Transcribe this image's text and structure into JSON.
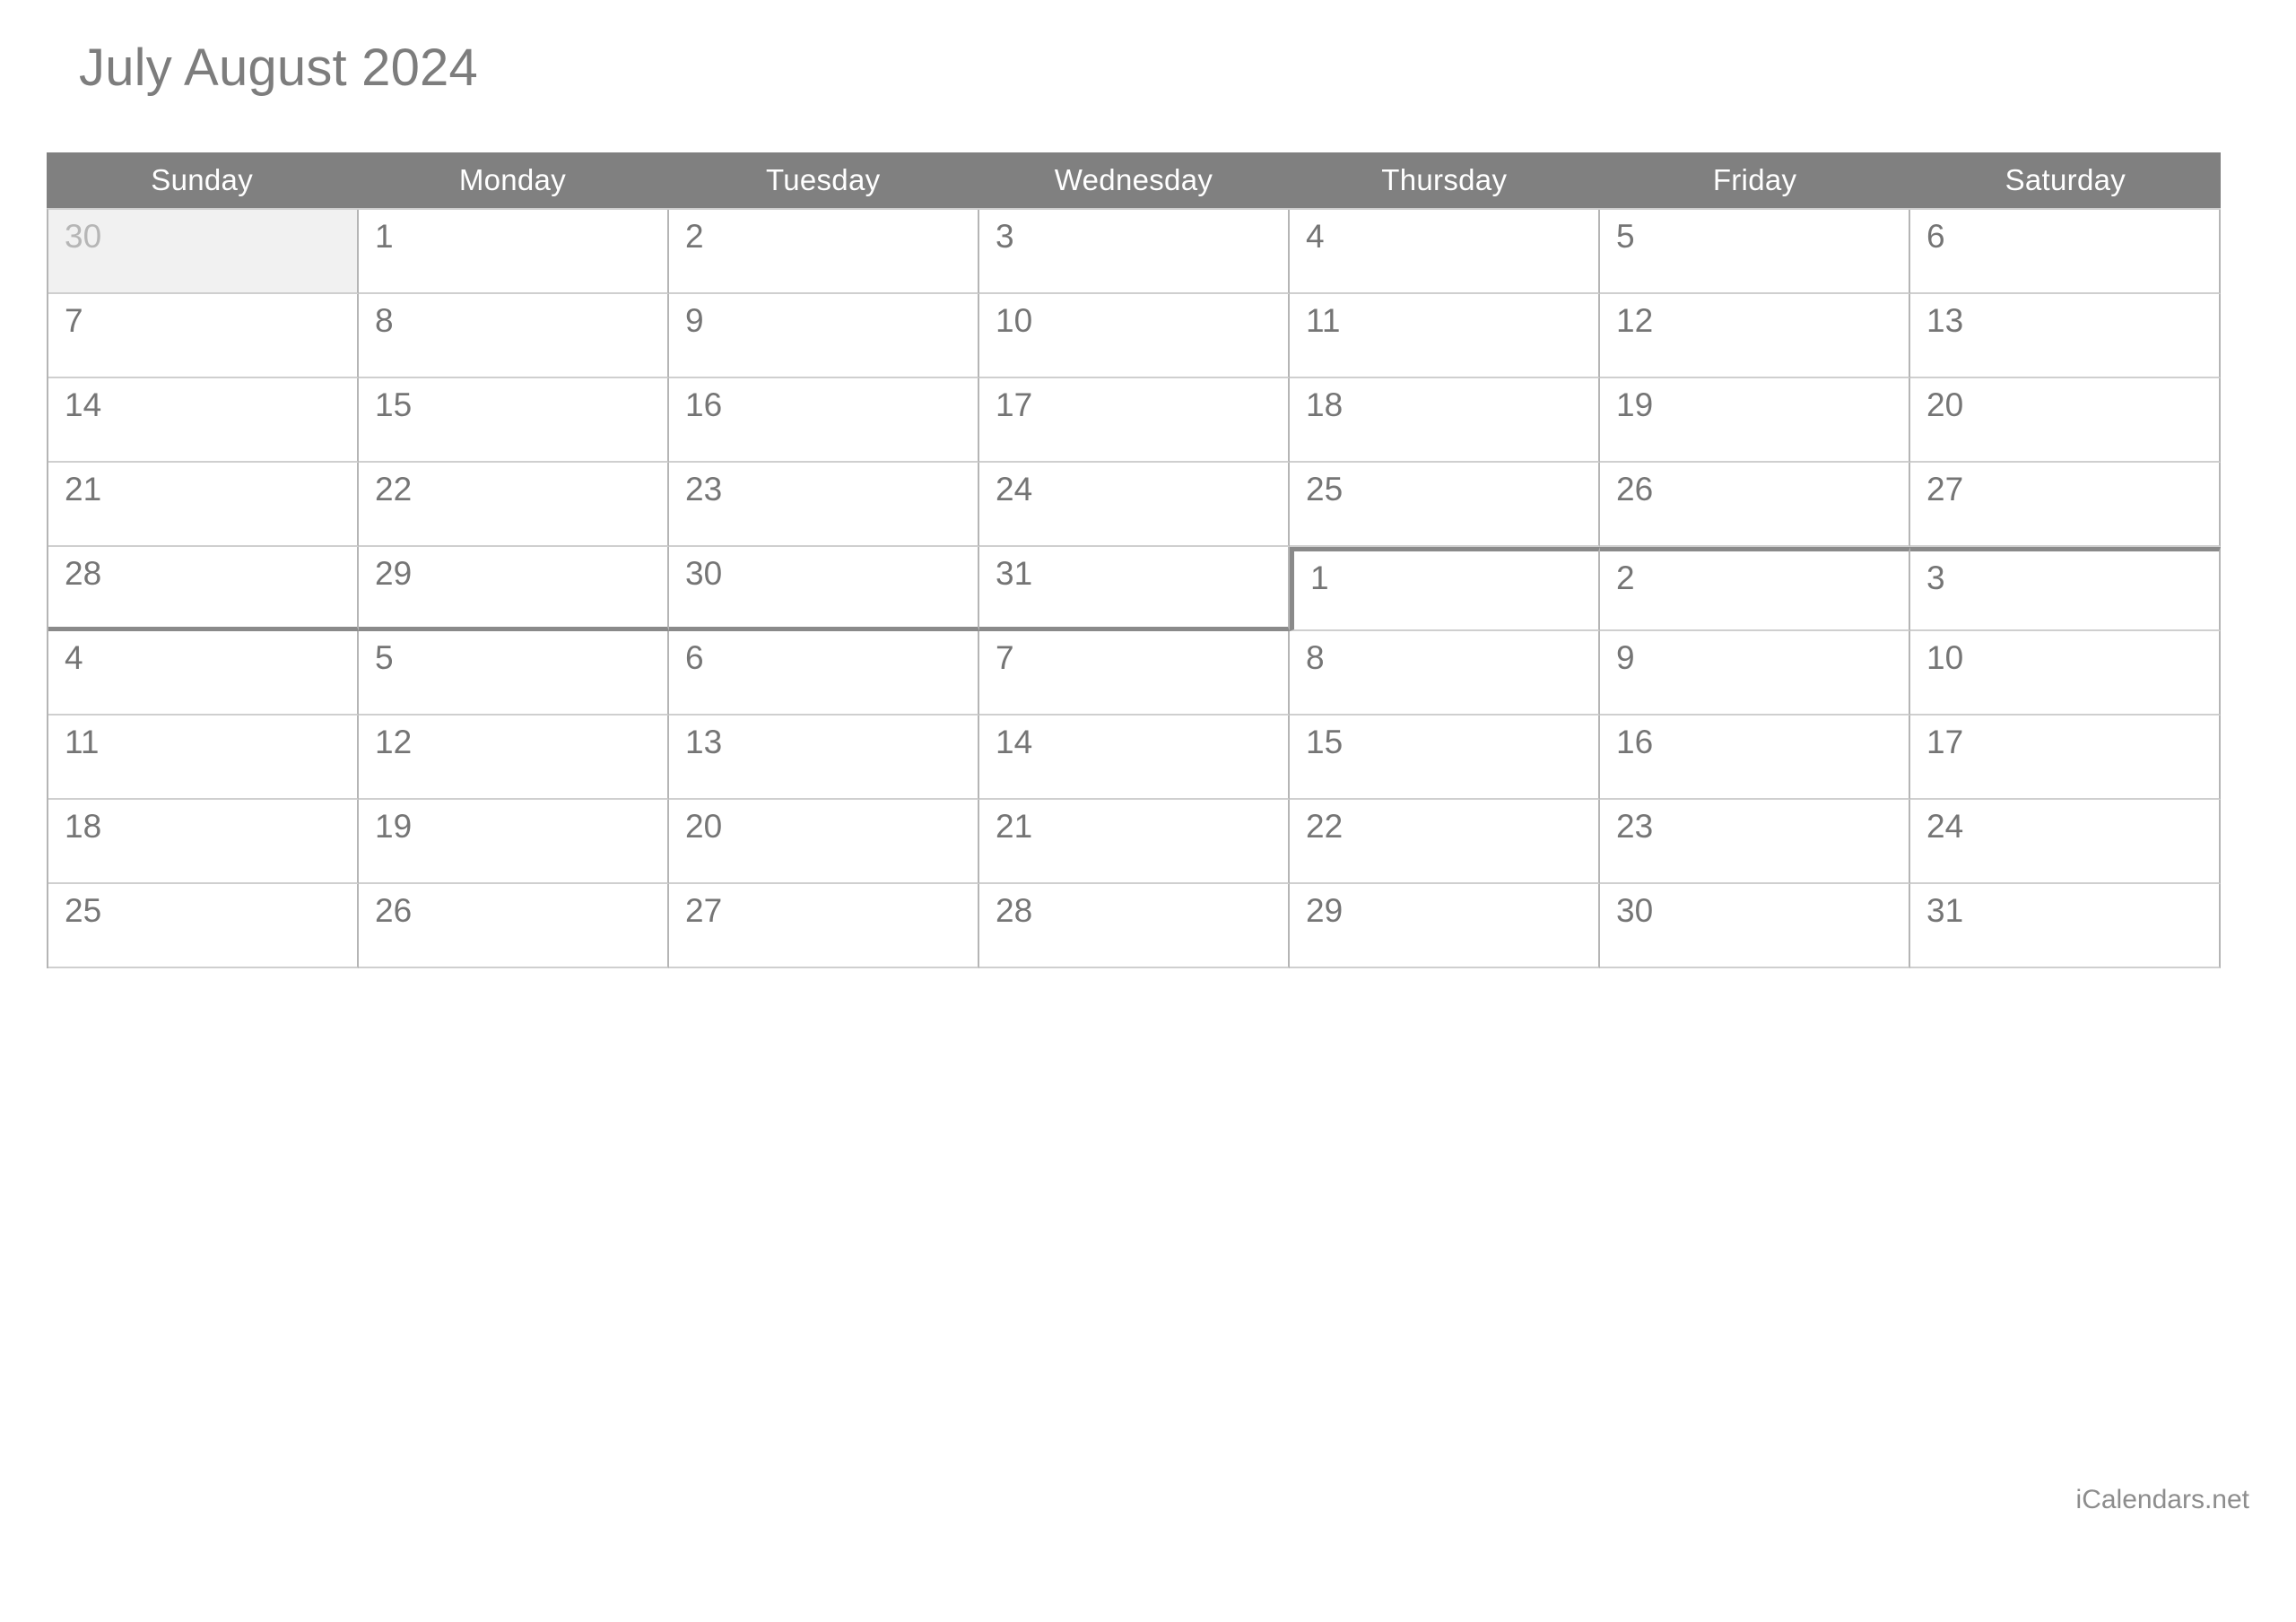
{
  "title": "July August 2024",
  "footer": "iCalendars.net",
  "colors": {
    "header_band": "#808080",
    "header_text": "#ffffff",
    "day_number": "#757575",
    "muted_day_number": "#b6b6b6",
    "muted_cell_bg": "#f1f1f1",
    "grid_line": "#b5b5b5",
    "month_boundary": "#8a8a8a",
    "title_text": "#7d7d7d",
    "footer_text": "#8d8d8d"
  },
  "weekdays": [
    "Sunday",
    "Monday",
    "Tuesday",
    "Wednesday",
    "Thursday",
    "Friday",
    "Saturday"
  ],
  "weeks": [
    {
      "days": [
        {
          "num": "30",
          "muted": true
        },
        {
          "num": "1"
        },
        {
          "num": "2"
        },
        {
          "num": "3"
        },
        {
          "num": "4"
        },
        {
          "num": "5"
        },
        {
          "num": "6"
        }
      ]
    },
    {
      "days": [
        {
          "num": "7"
        },
        {
          "num": "8"
        },
        {
          "num": "9"
        },
        {
          "num": "10"
        },
        {
          "num": "11"
        },
        {
          "num": "12"
        },
        {
          "num": "13"
        }
      ]
    },
    {
      "days": [
        {
          "num": "14"
        },
        {
          "num": "15"
        },
        {
          "num": "16"
        },
        {
          "num": "17"
        },
        {
          "num": "18"
        },
        {
          "num": "19"
        },
        {
          "num": "20"
        }
      ]
    },
    {
      "days": [
        {
          "num": "21"
        },
        {
          "num": "22"
        },
        {
          "num": "23"
        },
        {
          "num": "24"
        },
        {
          "num": "25"
        },
        {
          "num": "26"
        },
        {
          "num": "27"
        }
      ]
    },
    {
      "days": [
        {
          "num": "28",
          "edge_bottom": true
        },
        {
          "num": "29",
          "edge_bottom": true
        },
        {
          "num": "30",
          "edge_bottom": true
        },
        {
          "num": "31",
          "edge_bottom": true
        },
        {
          "num": "1",
          "edge_top": true,
          "edge_left": true
        },
        {
          "num": "2",
          "edge_top": true
        },
        {
          "num": "3",
          "edge_top": true
        }
      ]
    },
    {
      "days": [
        {
          "num": "4"
        },
        {
          "num": "5"
        },
        {
          "num": "6"
        },
        {
          "num": "7"
        },
        {
          "num": "8"
        },
        {
          "num": "9"
        },
        {
          "num": "10"
        }
      ]
    },
    {
      "days": [
        {
          "num": "11"
        },
        {
          "num": "12"
        },
        {
          "num": "13"
        },
        {
          "num": "14"
        },
        {
          "num": "15"
        },
        {
          "num": "16"
        },
        {
          "num": "17"
        }
      ]
    },
    {
      "days": [
        {
          "num": "18"
        },
        {
          "num": "19"
        },
        {
          "num": "20"
        },
        {
          "num": "21"
        },
        {
          "num": "22"
        },
        {
          "num": "23"
        },
        {
          "num": "24"
        }
      ]
    },
    {
      "days": [
        {
          "num": "25"
        },
        {
          "num": "26"
        },
        {
          "num": "27"
        },
        {
          "num": "28"
        },
        {
          "num": "29"
        },
        {
          "num": "30"
        },
        {
          "num": "31"
        }
      ]
    }
  ]
}
